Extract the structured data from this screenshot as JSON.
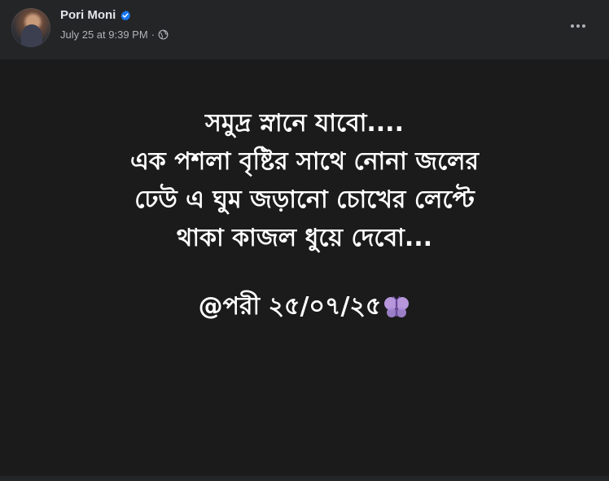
{
  "post": {
    "author": {
      "name": "Pori Moni",
      "verified": true,
      "avatar_icon": "profile-photo"
    },
    "timestamp": "July 25 at 9:39 PM",
    "separator": "·",
    "privacy_icon": "globe-icon",
    "more_icon": "more-options-icon",
    "text_lines": [
      "সমুদ্র স্নানে যাবো....",
      "এক পশলা বৃষ্টির সাথে নোনা জলের",
      "ঢেউ এ ঘুম জড়ানো চোখের লেপ্টে",
      "থাকা কাজল ধুয়ে দেবো..."
    ],
    "signature": "@পরী ২৫/০৭/২৫",
    "signature_icon": "butterfly-icon",
    "colors": {
      "card_background": "#242526",
      "post_background": "#1b1b1b",
      "text": "#ffffff",
      "name_text": "#e4e6eb",
      "meta_text": "#b0b3b8",
      "verified_blue": "#1877f2"
    }
  }
}
